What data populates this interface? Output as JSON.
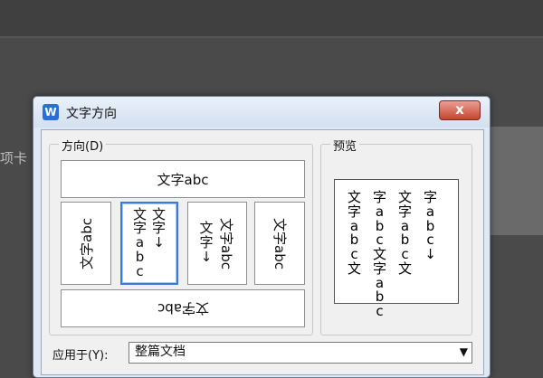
{
  "background": {
    "left_text": "项卡"
  },
  "dialog": {
    "title": "文字方向",
    "app_icon": "W",
    "close_symbol": "x",
    "direction_label": "方向(D)",
    "preview_label": "预览",
    "options": {
      "horizontal": "文字abc",
      "rot_a": "文字abc",
      "vert_col1": [
        "文",
        "字",
        "a",
        "b",
        "c"
      ],
      "vert_col2": [
        "文",
        "字",
        "↓"
      ],
      "rot_b_col1": [
        "文",
        "字",
        "↓"
      ],
      "rot_b_col2": "文字abc",
      "rot_c": "文字abc",
      "bottom": "文字abc"
    },
    "preview": {
      "col1": [
        "文",
        "字",
        "a",
        "b",
        "c",
        "文"
      ],
      "col2": [
        "字",
        "a",
        "b",
        "c",
        "文",
        "字",
        "a",
        "b",
        "c"
      ],
      "col3": [
        "文",
        "字",
        "a",
        "b",
        "c",
        "文"
      ],
      "col4": [
        "字",
        "a",
        "b",
        "c",
        "↓"
      ]
    },
    "apply_to_label": "应用于(Y):",
    "apply_to_value": "整篇文档"
  }
}
